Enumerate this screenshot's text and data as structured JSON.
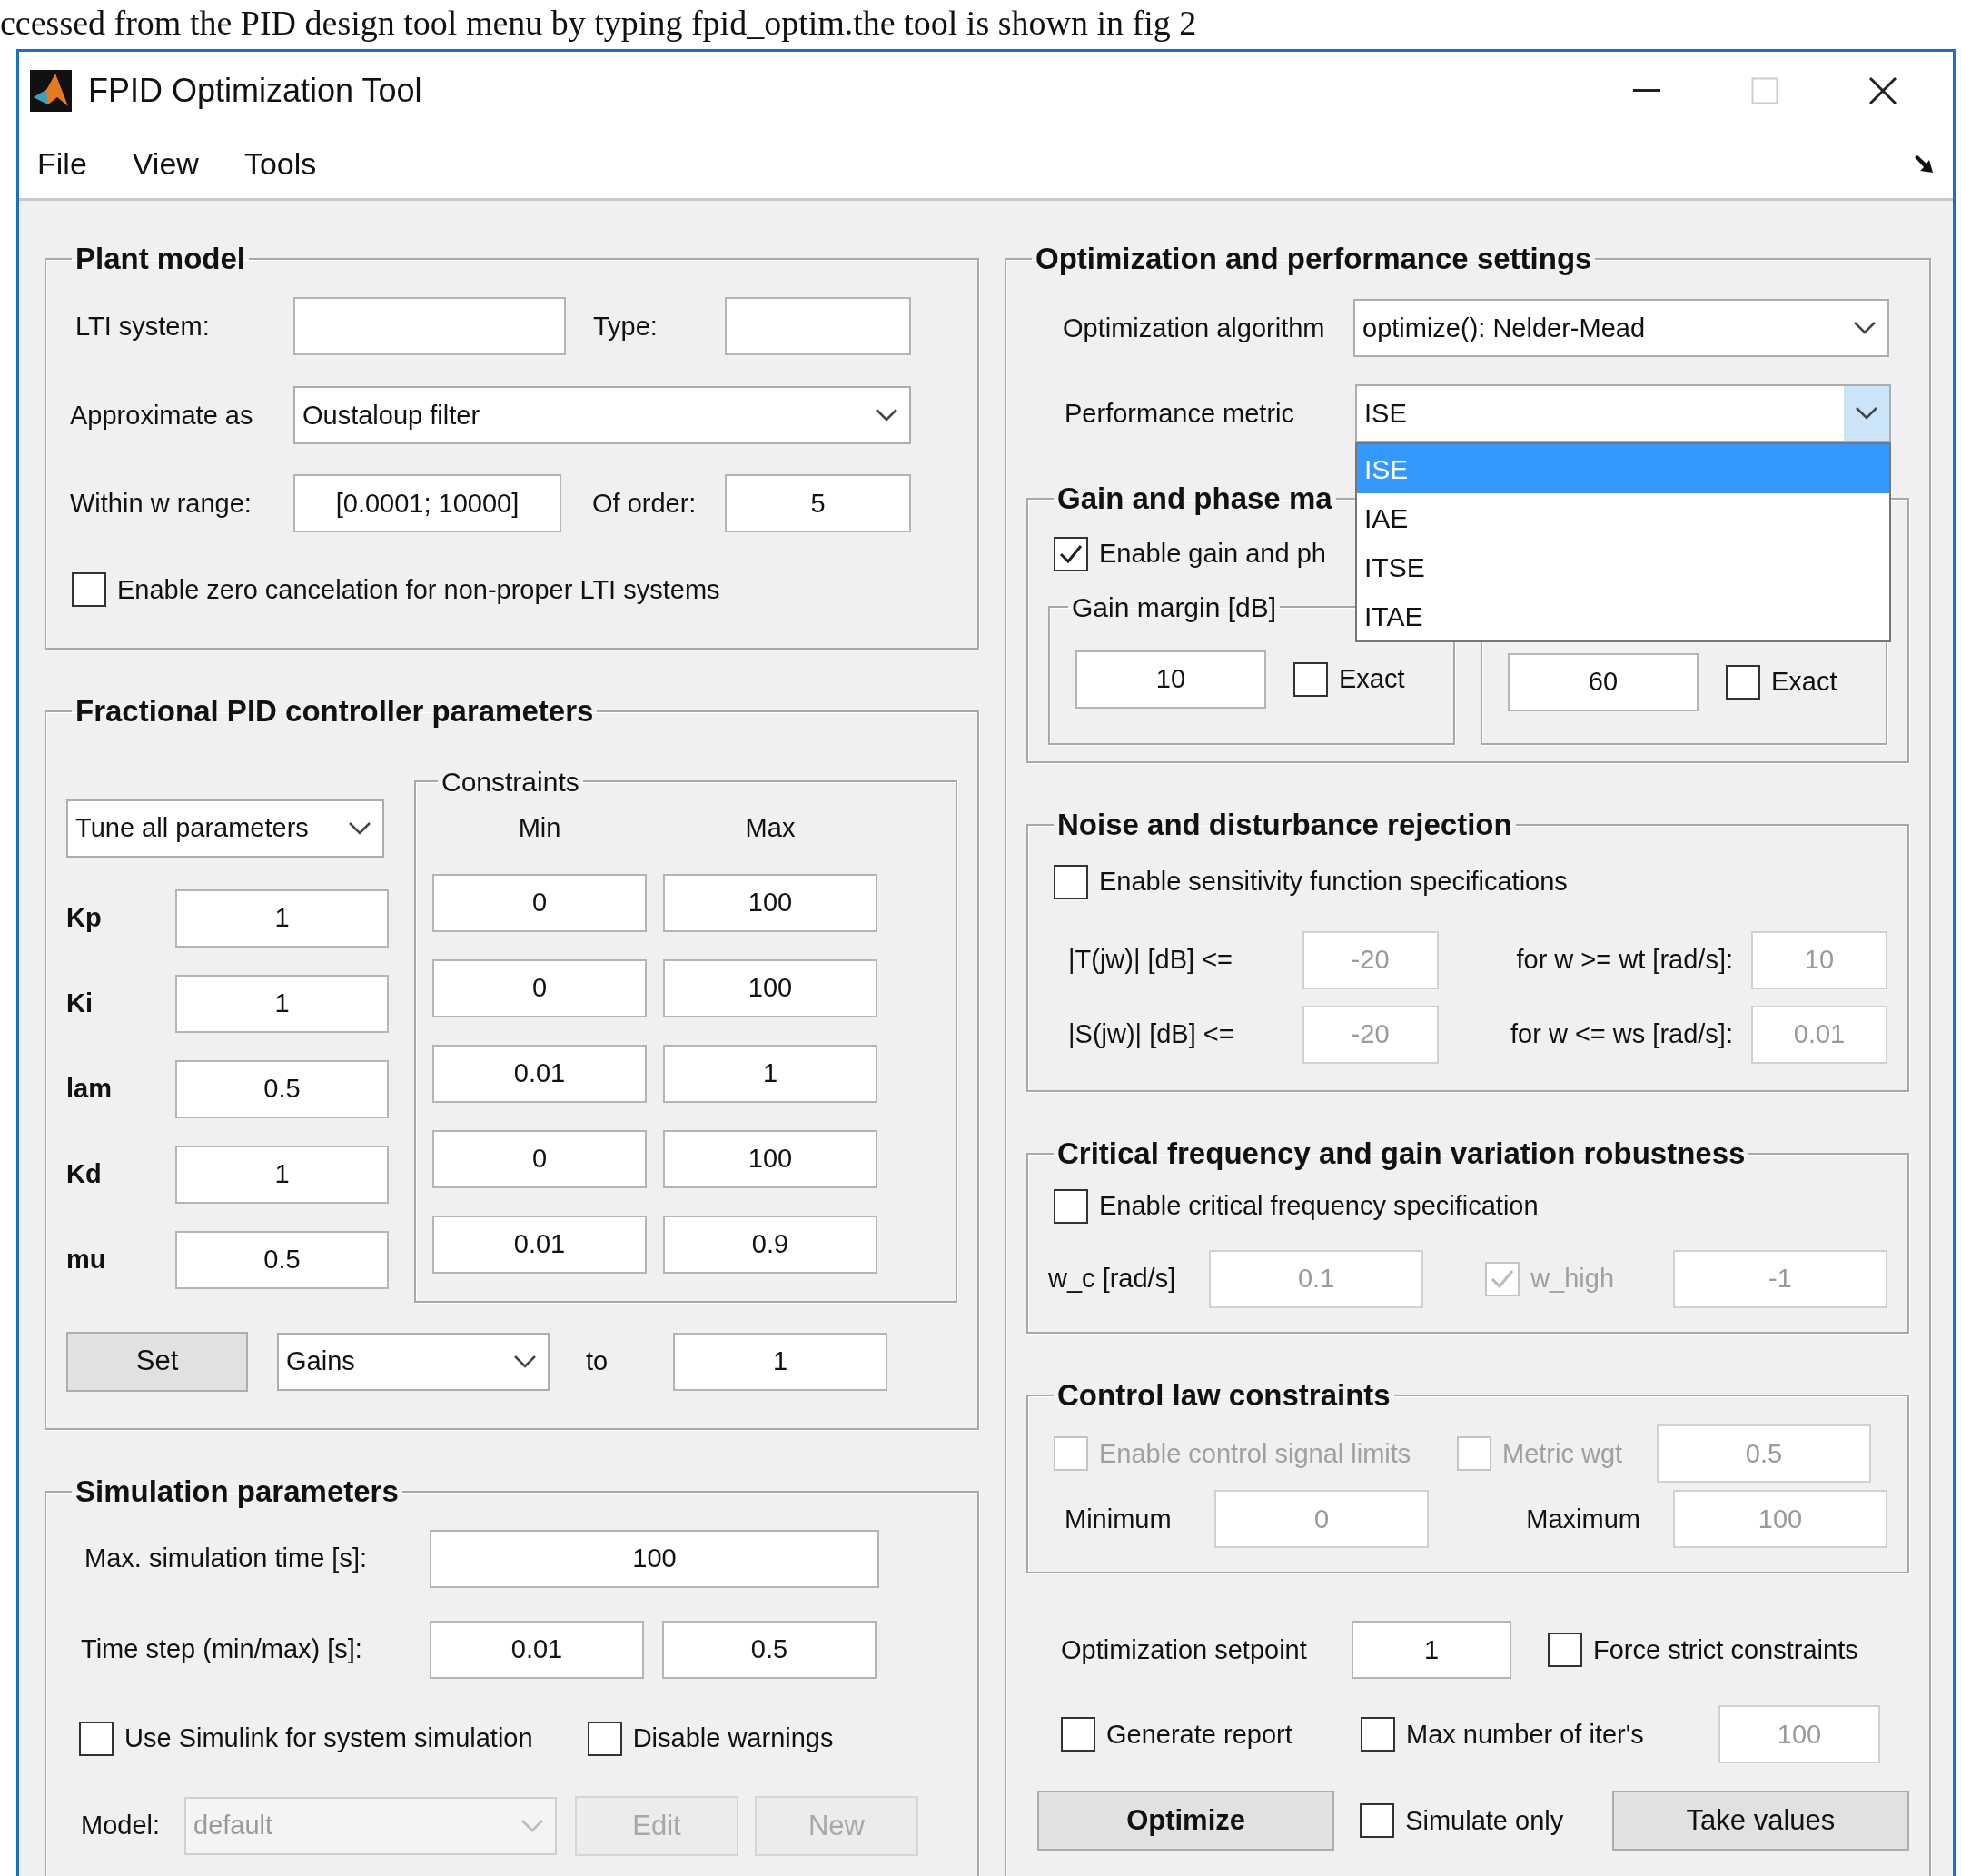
{
  "intro_text": "ccessed from the PID design tool menu by typing fpid_optim.the tool is shown in fig 2",
  "window": {
    "title": "FPID Optimization Tool",
    "maximize_disabled": true
  },
  "menu": [
    {
      "label": "File"
    },
    {
      "label": "View"
    },
    {
      "label": "Tools"
    }
  ],
  "plant_model": {
    "title": "Plant model",
    "lti_label": "LTI system:",
    "type_label": "Type:",
    "approx_label": "Approximate as",
    "approx_value": "Oustaloup filter",
    "range_label": "Within w range:",
    "range_value": "[0.0001; 10000]",
    "order_label": "Of order:",
    "order_value": "5",
    "zero_cancel": {
      "label": "Enable zero cancelation for non-proper LTI systems",
      "checked": false
    }
  },
  "pid": {
    "title": "Fractional PID controller parameters",
    "tune_mode": "Tune all parameters",
    "constraints_title": "Constraints",
    "min_label": "Min",
    "max_label": "Max",
    "params": [
      {
        "name": "Kp",
        "value": "1",
        "min": "0",
        "max": "100"
      },
      {
        "name": "Ki",
        "value": "1",
        "min": "0",
        "max": "100"
      },
      {
        "name": "lam",
        "value": "0.5",
        "min": "0.01",
        "max": "1"
      },
      {
        "name": "Kd",
        "value": "1",
        "min": "0",
        "max": "100"
      },
      {
        "name": "mu",
        "value": "0.5",
        "min": "0.01",
        "max": "0.9"
      }
    ],
    "set_button": "Set",
    "set_target": "Gains",
    "to_label": "to",
    "set_value": "1"
  },
  "simulation": {
    "title": "Simulation parameters",
    "max_time_label": "Max. simulation time [s]:",
    "max_time": "100",
    "step_label": "Time step (min/max) [s]:",
    "step_min": "0.01",
    "step_max": "0.5",
    "checks": [
      {
        "label": "Use Simulink for system simulation",
        "checked": false
      },
      {
        "label": "Disable warnings",
        "checked": false
      }
    ],
    "model_label": "Model:",
    "model_value": "default",
    "model_disabled": true,
    "buttons": [
      {
        "label": "Edit",
        "disabled": true
      },
      {
        "label": "New",
        "disabled": true
      }
    ]
  },
  "optimization": {
    "title": "Optimization and performance settings",
    "algorithm_label": "Optimization algorithm",
    "algorithm": "optimize(): Nelder-Mead",
    "metric_label": "Performance metric",
    "metric": "ISE",
    "metric_options": [
      {
        "label": "ISE",
        "selected": true
      },
      {
        "label": "IAE",
        "selected": false
      },
      {
        "label": "ITSE",
        "selected": false
      },
      {
        "label": "ITAE",
        "selected": false
      }
    ]
  },
  "gain_phase": {
    "title": "Gain and phase ma",
    "enable": {
      "label": "Enable gain and ph",
      "checked": true
    },
    "gain_title": "Gain margin [dB]",
    "gain_value": "10",
    "gain_exact": {
      "label": "Exact",
      "checked": false
    },
    "phase_value": "60",
    "phase_exact": {
      "label": "Exact",
      "checked": false
    }
  },
  "noise": {
    "title": "Noise and disturbance rejection",
    "enable": {
      "label": "Enable sensitivity function specifications",
      "checked": false
    },
    "disabled": true,
    "rows": [
      {
        "label": "|T(jw)| [dB] <=",
        "value": "-20",
        "for_label": "for w >= wt [rad/s]:",
        "for_value": "10"
      },
      {
        "label": "|S(jw)| [dB] <=",
        "value": "-20",
        "for_label": "for w <= ws [rad/s]:",
        "for_value": "0.01"
      }
    ]
  },
  "critical": {
    "title": "Critical frequency and gain variation robustness",
    "enable": {
      "label": "Enable critical frequency specification",
      "checked": false
    },
    "disabled": true,
    "wc_label": "w_c [rad/s]",
    "wc_value": "0.1",
    "whigh": {
      "label": "w_high",
      "checked": true
    },
    "whigh_value": "-1"
  },
  "control_law": {
    "title": "Control law constraints",
    "disabled": true,
    "enable": {
      "label": "Enable control signal limits",
      "checked": false
    },
    "metric_wgt": {
      "label": "Metric wgt",
      "checked": false
    },
    "metric_wgt_value": "0.5",
    "min_label": "Minimum",
    "min_value": "0",
    "max_label": "Maximum",
    "max_value": "100"
  },
  "bottom": {
    "setpoint_label": "Optimization setpoint",
    "setpoint": "1",
    "force": {
      "label": "Force strict constraints",
      "checked": false
    },
    "report": {
      "label": "Generate report",
      "checked": false
    },
    "max_iter": {
      "label": "Max number of iter's",
      "checked": false
    },
    "max_iter_value": "100",
    "max_iter_disabled": true,
    "optimize": "Optimize",
    "simulate_only": {
      "label": "Simulate only",
      "checked": false
    },
    "take_values": "Take values"
  }
}
